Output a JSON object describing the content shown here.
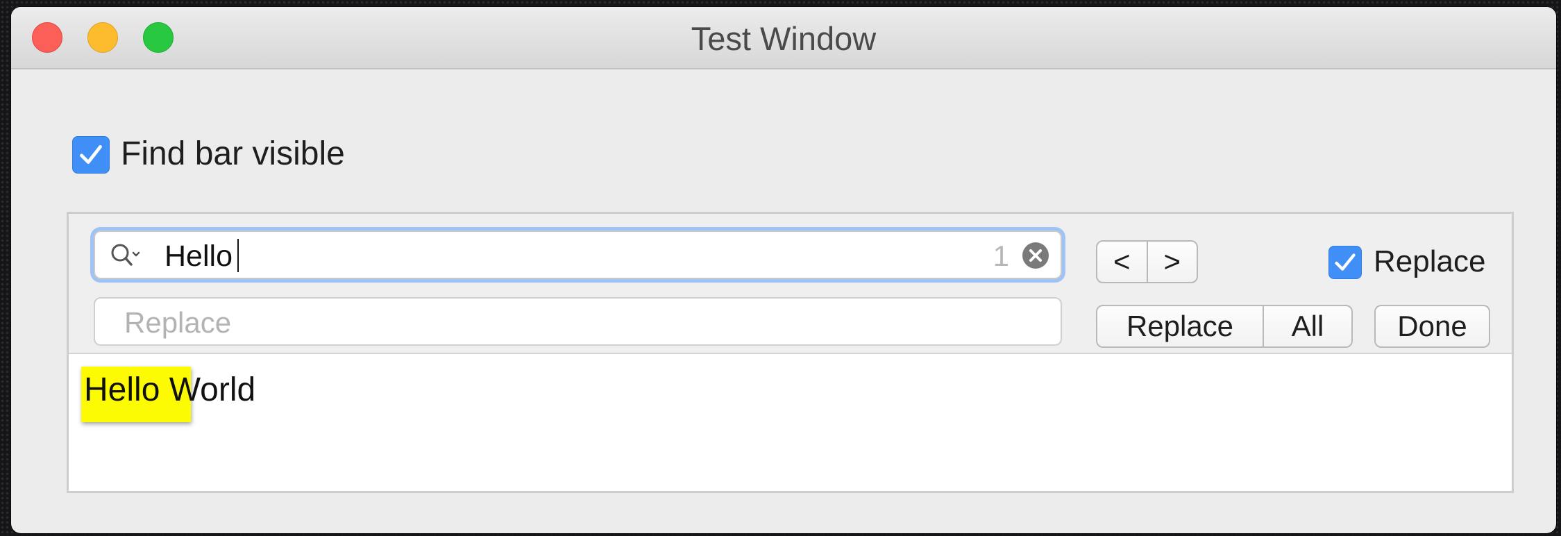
{
  "window": {
    "title": "Test Window"
  },
  "options": {
    "find_bar_visible_label": "Find bar visible",
    "find_bar_visible_checked": true
  },
  "find_bar": {
    "search_value": "Hello",
    "match_count": "1",
    "replace_placeholder": "Replace",
    "prev_label": "<",
    "next_label": ">",
    "replace_toggle_label": "Replace",
    "replace_toggle_checked": true,
    "replace_button_label": "Replace",
    "replace_all_button_label": "All",
    "done_button_label": "Done"
  },
  "document": {
    "highlighted_word": "Hello",
    "rest_text": " World"
  },
  "colors": {
    "accent": "#3f8ff6",
    "focus_ring": "#9fc3f4",
    "highlight": "#fdfb04"
  },
  "icons": {
    "search": "search-icon",
    "clear": "clear-icon",
    "checkmark": "checkmark-icon"
  }
}
